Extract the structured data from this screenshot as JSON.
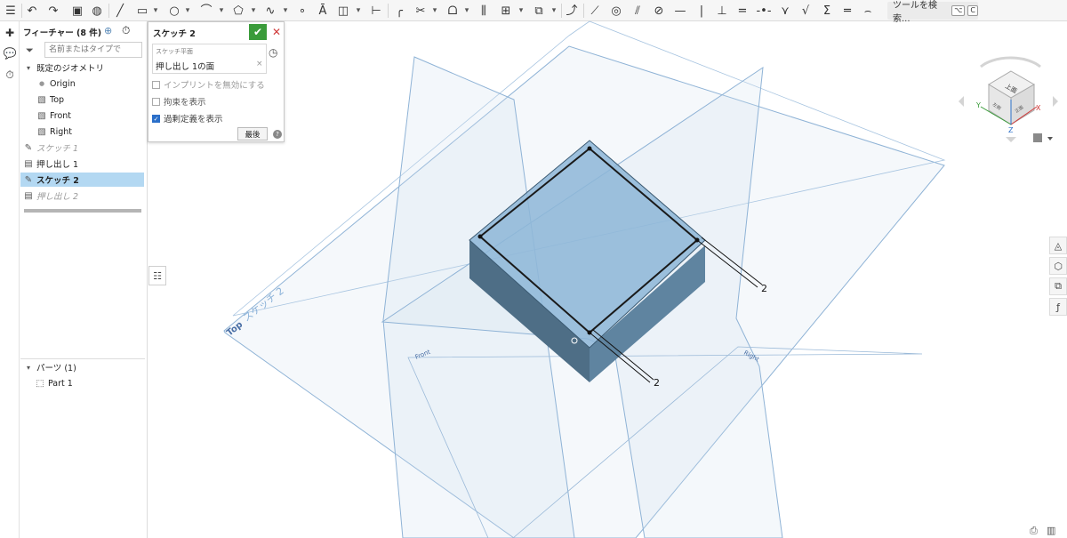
{
  "toolbar": {
    "search_label": "ツールを検索...",
    "search_key1": "⌥",
    "search_key2": "C"
  },
  "feature_panel": {
    "title": "フィーチャー (8 件)",
    "filter_placeholder": "名前またはタイプで",
    "default_geometry_label": "既定のジオメトリ",
    "items": [
      {
        "label": "Origin"
      },
      {
        "label": "Top"
      },
      {
        "label": "Front"
      },
      {
        "label": "Right"
      },
      {
        "label": "スケッチ 1"
      },
      {
        "label": "押し出し 1"
      },
      {
        "label": "スケッチ 2"
      },
      {
        "label": "押し出し 2"
      }
    ],
    "parts_header": "パーツ (1)",
    "part_label": "Part 1"
  },
  "sketch_dialog": {
    "title": "スケッチ 2",
    "plane_label": "スケッチ平面",
    "plane_value": "押し出し 1の面",
    "opt_disable_imprint": "インプリントを無効にする",
    "opt_show_constraints": "拘束を表示",
    "opt_show_overdefined": "過剰定義を表示",
    "opt_show_overdefined_checked": true,
    "final_button": "最後"
  },
  "viewport": {
    "plane_top_label": "Top",
    "plane_front_label": "Front",
    "plane_right_label": "Right",
    "sketch_label": "スケッチ 2",
    "dim_labels": [
      "2",
      "2"
    ],
    "view_cube_face": "上面",
    "view_cube_left": "左側",
    "view_cube_right": "正面",
    "axes": {
      "x": "X",
      "y": "Y",
      "z": "Z"
    }
  },
  "colors": {
    "accent_green": "#3a9b3a",
    "accent_red": "#d03a3a",
    "selection_blue": "#b3d8f2",
    "plane_blue": "#8fb3d6",
    "box_face": "#6f9dbf"
  }
}
